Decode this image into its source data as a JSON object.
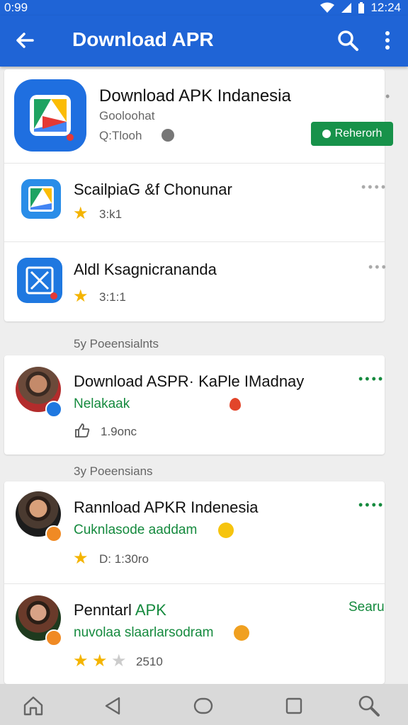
{
  "status": {
    "time_left": "0:99",
    "time_right": "12:24"
  },
  "appbar": {
    "title": "Download APR"
  },
  "featured": {
    "title": "Download APK Indanesia",
    "subtitle": "Gooloohat",
    "meta": "Q:Tlooh",
    "button": "Reherorh",
    "dot": "•"
  },
  "apps": [
    {
      "title": "ScailpiaG &f Chonunar",
      "rating": "3:k1",
      "more": "••••"
    },
    {
      "title": "Aldl Ksagnicrananda",
      "rating": "3:1:1",
      "more": "•••"
    }
  ],
  "sections": [
    "5y Poeensialnts",
    "3y Poeensians"
  ],
  "posts": [
    {
      "title": "Download ASPR· KaPle IMadnay",
      "sub": "Nelakaak",
      "likes": "1.9onc",
      "more": "••••"
    },
    {
      "title": "Rannload APKR Indenesia",
      "sub": "Cuknlasode aaddam",
      "meta": "D: 1:30ro",
      "more": "••••"
    },
    {
      "title_a": "Penntarl",
      "title_b": "APK",
      "sub": "nuvolaa slaarlarsodram",
      "rating": "2510",
      "action": "Searu"
    }
  ],
  "icons": [
    "back-arrow-icon",
    "search-icon",
    "more-vert-icon",
    "wifi-icon",
    "signal-icon",
    "battery-icon",
    "star-icon",
    "thumb-up-icon",
    "home-icon",
    "back-triangle-icon",
    "circle-home-icon",
    "square-recents-icon",
    "magnifier-icon"
  ],
  "colors": {
    "primary": "#1f64d6",
    "green": "#158a3e",
    "star": "#f4b400"
  }
}
